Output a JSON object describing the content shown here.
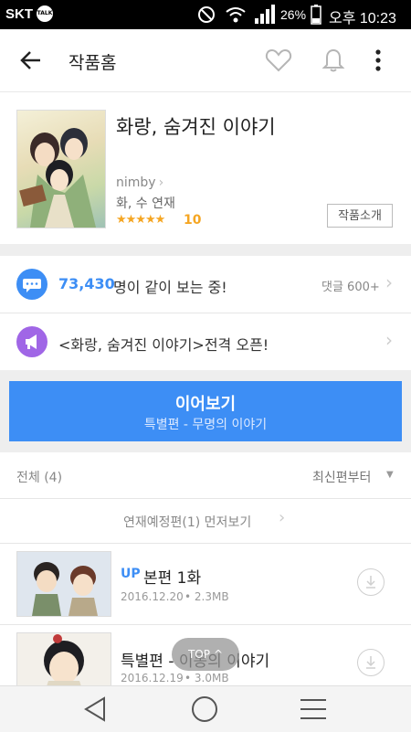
{
  "status_bar": {
    "carrier": "SKT",
    "talk_badge": "TALK",
    "battery": "26%",
    "time": "오후 10:23"
  },
  "app_bar": {
    "title": "작품홈"
  },
  "work": {
    "title": "화랑, 숨겨진 이야기",
    "author": "nimby",
    "schedule": "화, 수 연재",
    "stars": "★★★★★",
    "rating": "10",
    "intro_button": "작품소개"
  },
  "social": {
    "count": "73,430",
    "count_suffix": "명이 같이 보는 중!",
    "comments": "댓글 600+"
  },
  "announcement": {
    "text": "<화랑, 숨겨진 이야기>전격 오픈!"
  },
  "continue": {
    "label": "이어보기",
    "subtitle": "특별편 - 무명의 이야기"
  },
  "episodes_header": {
    "all": "전체 (4)",
    "sort": "최신편부터"
  },
  "preview_link": "연재예정편(1) 먼저보기",
  "episodes": [
    {
      "badge": "UP",
      "title": "본편 1화",
      "date": "2016.12.20",
      "size": "2.3MB"
    },
    {
      "badge": "",
      "title": "특별편 - 이몽의 이야기",
      "date": "2016.12.19",
      "size": "3.0MB"
    }
  ],
  "top_button": "TOP",
  "colors": {
    "accent": "#3d8ef5",
    "star": "#f5a623",
    "announce": "#a066e6"
  }
}
